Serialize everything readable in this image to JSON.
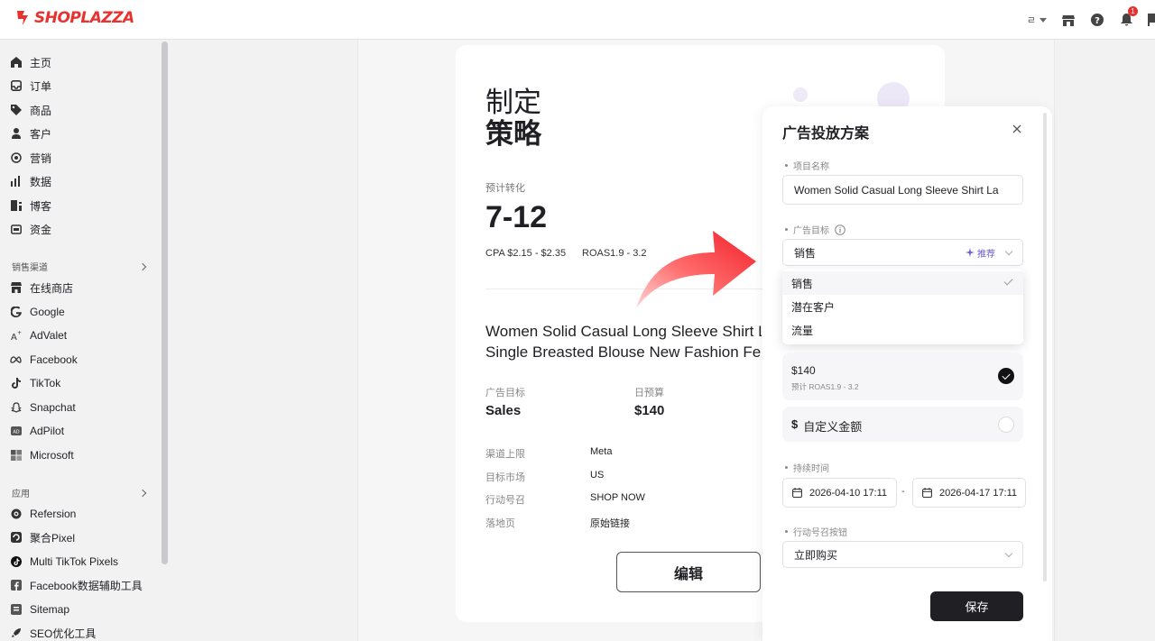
{
  "topbar": {
    "brand": "SHOPLAZZA",
    "lang": "ㄹ",
    "notification_count": "1"
  },
  "sidebar": {
    "items": [
      {
        "label": "主页",
        "icon": "home-icon"
      },
      {
        "label": "订单",
        "icon": "inbox-icon"
      },
      {
        "label": "商品",
        "icon": "tag-icon"
      },
      {
        "label": "客户",
        "icon": "person-icon"
      },
      {
        "label": "营销",
        "icon": "target-icon"
      },
      {
        "label": "数据",
        "icon": "bar-chart-icon"
      },
      {
        "label": "博客",
        "icon": "blog-icon"
      },
      {
        "label": "资金",
        "icon": "wallet-icon"
      }
    ],
    "section_sales": "销售渠道",
    "channels": [
      {
        "label": "在线商店",
        "icon": "store-icon"
      },
      {
        "label": "Google",
        "icon": "google-icon"
      },
      {
        "label": "AdValet",
        "icon": "advalet-icon"
      },
      {
        "label": "Facebook",
        "icon": "meta-icon"
      },
      {
        "label": "TikTok",
        "icon": "tiktok-icon"
      },
      {
        "label": "Snapchat",
        "icon": "snapchat-icon"
      },
      {
        "label": "AdPilot",
        "icon": "adpilot-icon"
      },
      {
        "label": "Microsoft",
        "icon": "microsoft-icon"
      }
    ],
    "section_apps": "应用",
    "apps": [
      {
        "label": "Refersion",
        "icon": "refersion-icon"
      },
      {
        "label": "聚合Pixel",
        "icon": "pixel-icon"
      },
      {
        "label": "Multi TikTok Pixels",
        "icon": "tiktok-pixel-icon"
      },
      {
        "label": "Facebook数据辅助工具",
        "icon": "facebook-icon"
      },
      {
        "label": "Sitemap",
        "icon": "sitemap-icon"
      },
      {
        "label": "SEO优化工具",
        "icon": "rocket-icon"
      }
    ]
  },
  "strategy": {
    "title_line1": "制定",
    "title_line2": "策略",
    "est_label": "预计转化",
    "est_value": "7-12",
    "cpa": "CPA $2.15 - $2.35",
    "roas": "ROAS1.9 - 3.2",
    "product_title_line1": "Women Solid Casual Long Sleeve Shirt La",
    "product_title_line2": "Single Breasted Blouse New Fashion Fem",
    "goal_label": "广告目标",
    "goal_value": "Sales",
    "budget_label": "日预算",
    "budget_value": "$140",
    "details": [
      {
        "label": "渠道上限",
        "value": "Meta"
      },
      {
        "label": "目标市场",
        "value": "US"
      },
      {
        "label": "行动号召",
        "value": "SHOP NOW"
      },
      {
        "label": "落地页",
        "value": "原始链接"
      }
    ],
    "edit_label": "编辑"
  },
  "panel": {
    "title": "广告投放方案",
    "name_label": "项目名称",
    "name_value": "Women Solid Casual  Long Sleeve Shirt La",
    "goal_label": "广告目标",
    "goal_value": "销售",
    "recommend": "推荐",
    "goal_options": [
      "销售",
      "潜在客户",
      "流量"
    ],
    "budget_amount": "$140",
    "budget_sub": "预计 ROAS1.9 - 3.2",
    "custom_symbol": "$",
    "custom_label": "自定义金额",
    "duration_label": "持续时间",
    "start_date": "2026-04-10 17:11",
    "date_sep": "-",
    "end_date": "2026-04-17 17:11",
    "cta_label": "行动号召按钮",
    "cta_value": "立即购买",
    "save_label": "保存"
  },
  "colors": {
    "brand": "#e8322f",
    "accent": "#6b5bd6",
    "dark": "#1f1f24"
  }
}
